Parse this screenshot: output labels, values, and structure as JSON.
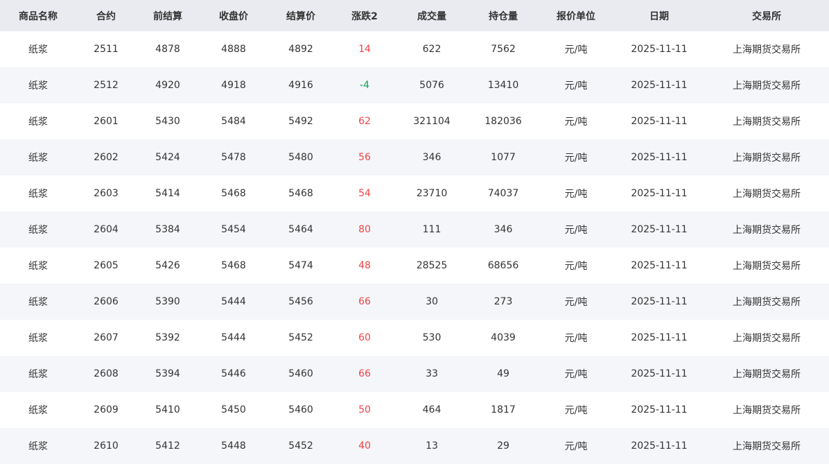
{
  "table": {
    "headers": [
      "商品名称",
      "合约",
      "前结算",
      "收盘价",
      "结算价",
      "涨跌2",
      "成交量",
      "持仓量",
      "报价单位",
      "日期",
      "交易所"
    ],
    "rows": [
      [
        "纸浆",
        "2511",
        "4878",
        "4888",
        "4892",
        "14",
        "622",
        "7562",
        "元/吨",
        "2025-11-11",
        "上海期货交易所"
      ],
      [
        "纸浆",
        "2512",
        "4920",
        "4918",
        "4916",
        "-4",
        "5076",
        "13410",
        "元/吨",
        "2025-11-11",
        "上海期货交易所"
      ],
      [
        "纸浆",
        "2601",
        "5430",
        "5484",
        "5492",
        "62",
        "321104",
        "182036",
        "元/吨",
        "2025-11-11",
        "上海期货交易所"
      ],
      [
        "纸浆",
        "2602",
        "5424",
        "5478",
        "5480",
        "56",
        "346",
        "1077",
        "元/吨",
        "2025-11-11",
        "上海期货交易所"
      ],
      [
        "纸浆",
        "2603",
        "5414",
        "5468",
        "5468",
        "54",
        "23710",
        "74037",
        "元/吨",
        "2025-11-11",
        "上海期货交易所"
      ],
      [
        "纸浆",
        "2604",
        "5384",
        "5454",
        "5464",
        "80",
        "111",
        "346",
        "元/吨",
        "2025-11-11",
        "上海期货交易所"
      ],
      [
        "纸浆",
        "2605",
        "5426",
        "5468",
        "5474",
        "48",
        "28525",
        "68656",
        "元/吨",
        "2025-11-11",
        "上海期货交易所"
      ],
      [
        "纸浆",
        "2606",
        "5390",
        "5444",
        "5456",
        "66",
        "30",
        "273",
        "元/吨",
        "2025-11-11",
        "上海期货交易所"
      ],
      [
        "纸浆",
        "2607",
        "5392",
        "5444",
        "5452",
        "60",
        "530",
        "4039",
        "元/吨",
        "2025-11-11",
        "上海期货交易所"
      ],
      [
        "纸浆",
        "2608",
        "5394",
        "5446",
        "5460",
        "66",
        "33",
        "49",
        "元/吨",
        "2025-11-11",
        "上海期货交易所"
      ],
      [
        "纸浆",
        "2609",
        "5410",
        "5450",
        "5460",
        "50",
        "464",
        "1817",
        "元/吨",
        "2025-11-11",
        "上海期货交易所"
      ],
      [
        "纸浆",
        "2610",
        "5412",
        "5448",
        "5452",
        "40",
        "13",
        "29",
        "元/吨",
        "2025-11-11",
        "上海期货交易所"
      ]
    ]
  },
  "colors": {
    "header_bg": "#e9ebf1",
    "row_alt_bg": "#f4f6f9",
    "up": "#ef4444",
    "down": "#10a050"
  }
}
